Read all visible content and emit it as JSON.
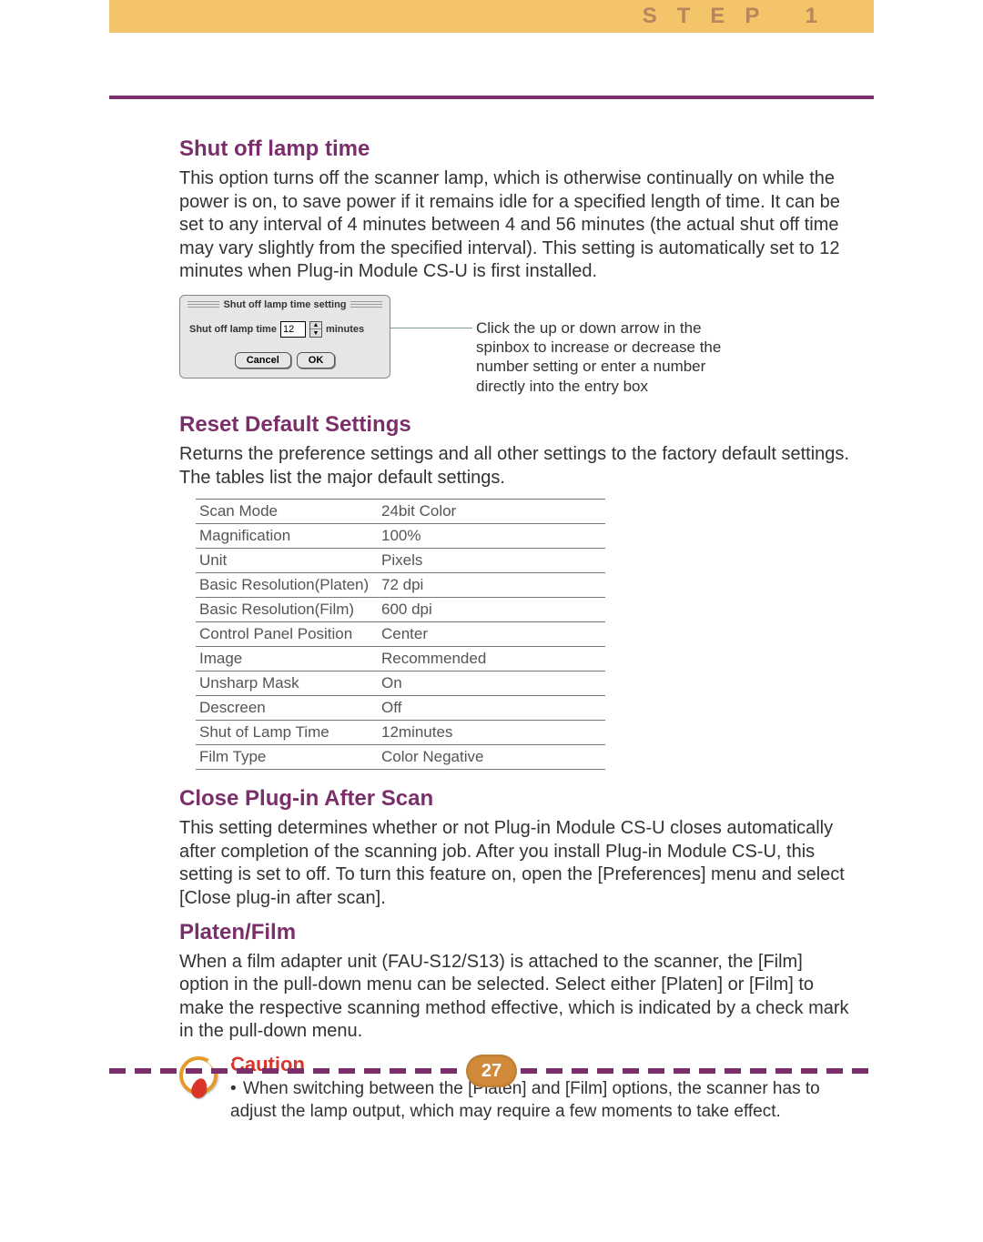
{
  "header": {
    "step_label": "STEP 1"
  },
  "sections": {
    "shutoff": {
      "title": "Shut off lamp time",
      "body": "This option turns off the scanner lamp, which is otherwise continually on while the power is on, to save power if it remains idle for a specified length of time. It can be set to any interval of 4 minutes between 4 and 56 minutes (the actual shut off time may vary slightly from the specified interval). This setting is automatically set to 12 minutes when Plug-in Module CS-U is first installed."
    },
    "dialog": {
      "title": "Shut off lamp time setting",
      "label": "Shut off lamp time",
      "value": "12",
      "unit": "minutes",
      "cancel": "Cancel",
      "ok": "OK",
      "callout": "Click the up or down arrow in the spinbox to increase or decrease the number setting or enter a number directly into the entry box"
    },
    "reset": {
      "title": "Reset Default Settings",
      "body": "Returns the preference settings and all other settings to the factory default settings. The tables list the major default settings."
    },
    "defaults": [
      {
        "k": "Scan Mode",
        "v": "24bit Color"
      },
      {
        "k": "Magnification",
        "v": "100%"
      },
      {
        "k": "Unit",
        "v": "Pixels"
      },
      {
        "k": "Basic Resolution(Platen)",
        "v": "72 dpi"
      },
      {
        "k": "Basic Resolution(Film)",
        "v": "600 dpi"
      },
      {
        "k": "Control Panel Position",
        "v": "Center"
      },
      {
        "k": "Image",
        "v": "Recommended"
      },
      {
        "k": "Unsharp Mask",
        "v": "On"
      },
      {
        "k": "Descreen",
        "v": "Off"
      },
      {
        "k": "Shut of Lamp Time",
        "v": "12minutes"
      },
      {
        "k": "Film Type",
        "v": "Color Negative"
      }
    ],
    "close": {
      "title": "Close Plug-in After Scan",
      "body": "This setting determines whether or not Plug-in Module CS-U closes automatically after completion of the scanning job. After you install Plug-in Module CS-U, this setting is set to off. To turn this feature on, open the [Preferences] menu and select [Close plug-in after scan]."
    },
    "platen": {
      "title": "Platen/Film",
      "body": "When a film adapter unit (FAU-S12/S13) is attached to the scanner, the [Film] option in the pull-down menu can be selected. Select either [Platen] or [Film] to make the respective scanning method effective, which is indicated by a check mark in the pull-down menu."
    },
    "caution": {
      "title": "Caution",
      "body": "When switching between the [Platen] and [Film] options, the scanner has to adjust the lamp output, which may require a few moments to take effect."
    }
  },
  "footer": {
    "page": "27"
  }
}
